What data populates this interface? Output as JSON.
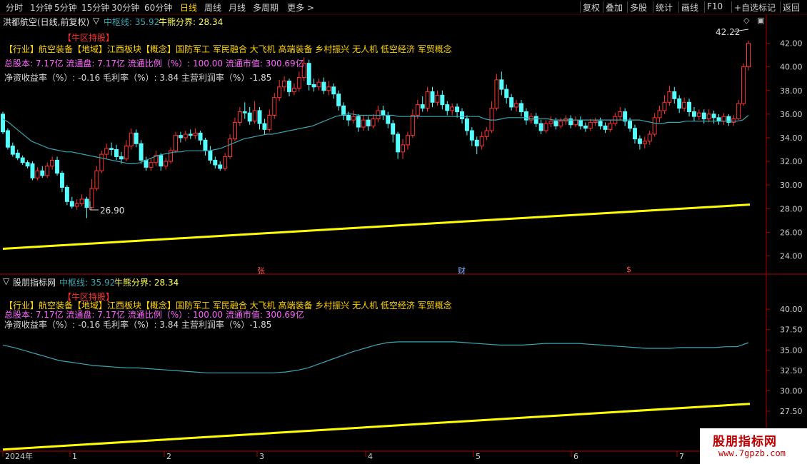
{
  "toolbar": {
    "periods": [
      "分时",
      "1分钟",
      "5分钟",
      "15分钟",
      "30分钟",
      "60分钟",
      "日线",
      "周线",
      "月线",
      "多周期",
      "更多 >"
    ],
    "active_period": "日线",
    "actions": [
      "复权",
      "叠加",
      "多股",
      "统计",
      "画线",
      "F10",
      "+自选",
      "返回"
    ],
    "mark_label": "标记"
  },
  "upper": {
    "title": "洪都航空(日线,前复权)",
    "zhongshu_label": "中枢线: 35.92",
    "niuxiong_label": "牛熊分界: 28.34",
    "badge": "【牛区持股】",
    "line1": "【行业】航空装备【地域】江西板块【概念】国防军工 军民融合 大飞机 高端装备 乡村振兴 无人机 低空经济 军贸概念",
    "line2": "总股本: 7.17亿 流通盘: 7.17亿 流通比例（%）: 100.00 流通市值: 300.69亿",
    "line3": "净资收益率（%）: -0.16 毛利率（%）: 3.84 主营利润率（%）-1.85",
    "high_label": "42.22",
    "low_label": "26.90",
    "event_marks": [
      "张",
      "财",
      "$"
    ]
  },
  "lower": {
    "title": "股朋指标网",
    "zhongshu_label": "中枢线: 35.92",
    "niuxiong_label": "牛熊分界: 28.34",
    "badge": "【牛区持股】",
    "line1": "【行业】航空装备【地域】江西板块【概念】国防军工 军民融合 大飞机 高端装备 乡村振兴 无人机 低空经济 军贸概念",
    "line2": "总股本: 7.17亿 流通盘: 7.17亿 流通比例（%）: 100.00 流通市值: 300.69亿",
    "line3": "净资收益率（%）: -0.16 毛利率（%）: 3.84 主营利润率（%）-1.85"
  },
  "xaxis": {
    "labels": [
      "2024年",
      "1",
      "2",
      "3",
      "4",
      "5",
      "6",
      "7"
    ]
  },
  "watermark": {
    "title": "股朋指标网",
    "url": "www.7gpzb.com"
  },
  "colors": {
    "up": "#ff3232",
    "down": "#54ffff",
    "zhongshu": "#3aa6b0",
    "niuxiong": "#ffff00",
    "axis": "#b00000",
    "text_yellow": "#ffd400",
    "text_magenta": "#ff66ff",
    "text_red": "#ff3030"
  },
  "chart_data": [
    {
      "type": "candlestick",
      "title": "洪都航空(日线,前复权)",
      "ylim": [
        23,
        43
      ],
      "yticks": [
        24,
        26,
        28,
        30,
        32,
        34,
        36,
        38,
        40,
        42
      ],
      "series": [
        {
          "name": "中枢线",
          "values": [
            35.6,
            35.3,
            34.9,
            34.5,
            34.1,
            33.7,
            33.5,
            33.3,
            33.1,
            33.0,
            32.9,
            32.8,
            32.8,
            32.7,
            32.6,
            32.5,
            32.4,
            32.3,
            32.2,
            32.1,
            32.0,
            31.9,
            31.8,
            31.8,
            31.9,
            32.1,
            32.3,
            32.5,
            32.6,
            32.7,
            32.8,
            32.8,
            32.9,
            32.9,
            32.9,
            32.9,
            32.9,
            33.0,
            33.1,
            33.3,
            33.5,
            33.7,
            33.9,
            34.0,
            34.1,
            34.2,
            34.3,
            34.3,
            34.4,
            34.5,
            34.6,
            34.7,
            34.8,
            34.9,
            35.0,
            35.2,
            35.4,
            35.6,
            35.8,
            35.9,
            36.0,
            36.0,
            35.9,
            35.9,
            35.9,
            35.9,
            35.9,
            35.9,
            35.9,
            35.8,
            35.8,
            35.8,
            35.8,
            35.8,
            35.8,
            35.8,
            35.8,
            35.8,
            35.8,
            35.8,
            35.8,
            35.8,
            35.8,
            35.8,
            35.6,
            35.5,
            35.5,
            35.6,
            35.7,
            35.7,
            35.7,
            35.7,
            35.6,
            35.6,
            35.6,
            35.6,
            35.5,
            35.5,
            35.5,
            35.5,
            35.5,
            35.5,
            35.5,
            35.5,
            35.5,
            35.5,
            35.5,
            35.5,
            35.5,
            35.5,
            35.5,
            35.5,
            35.4,
            35.3,
            35.2,
            35.2,
            35.3,
            35.3,
            35.3,
            35.4,
            35.4,
            35.4,
            35.4,
            35.4,
            35.4,
            35.4,
            35.4,
            35.4,
            35.4,
            35.5,
            35.9
          ]
        },
        {
          "name": "牛熊分界",
          "values": [
            24.6,
            28.34
          ]
        }
      ],
      "candles": [
        [
          36.0,
          34.5,
          36.2,
          34.3
        ],
        [
          34.6,
          33.2,
          34.8,
          33.0
        ],
        [
          33.3,
          32.6,
          33.6,
          32.4
        ],
        [
          32.7,
          32.3,
          33.0,
          32.1
        ],
        [
          32.3,
          31.9,
          32.5,
          31.7
        ],
        [
          31.9,
          31.6,
          32.1,
          31.4
        ],
        [
          31.8,
          30.6,
          32.0,
          30.4
        ],
        [
          30.6,
          31.2,
          31.5,
          30.4
        ],
        [
          31.2,
          30.8,
          31.6,
          30.6
        ],
        [
          30.8,
          31.6,
          31.9,
          30.6
        ],
        [
          31.6,
          32.1,
          32.4,
          31.3
        ],
        [
          32.1,
          31.0,
          32.4,
          30.8
        ],
        [
          31.0,
          29.8,
          31.2,
          29.4
        ],
        [
          29.8,
          28.6,
          30.0,
          28.3
        ],
        [
          28.6,
          28.2,
          29.0,
          28.0
        ],
        [
          28.2,
          28.4,
          28.8,
          27.9
        ],
        [
          28.4,
          28.8,
          29.2,
          28.2
        ],
        [
          28.8,
          28.1,
          29.0,
          27.2
        ],
        [
          28.1,
          29.7,
          30.5,
          27.9
        ],
        [
          29.7,
          31.2,
          31.6,
          29.5
        ],
        [
          31.2,
          32.6,
          32.9,
          31.0
        ],
        [
          32.6,
          33.1,
          33.5,
          32.2
        ],
        [
          33.1,
          33.0,
          33.6,
          32.5
        ],
        [
          33.0,
          32.4,
          33.4,
          32.1
        ],
        [
          32.4,
          32.2,
          32.8,
          31.8
        ],
        [
          32.2,
          33.3,
          33.8,
          32.0
        ],
        [
          33.3,
          34.4,
          34.8,
          33.0
        ],
        [
          34.4,
          33.5,
          34.7,
          33.2
        ],
        [
          33.5,
          32.1,
          33.8,
          31.8
        ],
        [
          32.1,
          31.5,
          32.4,
          31.2
        ],
        [
          31.5,
          31.9,
          32.3,
          31.2
        ],
        [
          31.9,
          32.5,
          32.9,
          31.6
        ],
        [
          32.5,
          31.6,
          32.7,
          31.2
        ],
        [
          31.6,
          32.0,
          32.3,
          31.3
        ],
        [
          32.0,
          32.9,
          33.2,
          31.8
        ],
        [
          32.9,
          34.2,
          34.5,
          32.7
        ],
        [
          34.2,
          34.0,
          34.5,
          33.6
        ],
        [
          34.0,
          34.3,
          34.6,
          33.7
        ],
        [
          34.3,
          34.2,
          34.7,
          33.9
        ],
        [
          34.2,
          34.4,
          34.8,
          33.9
        ],
        [
          34.4,
          33.8,
          34.6,
          33.4
        ],
        [
          33.8,
          32.9,
          34.0,
          32.5
        ],
        [
          32.9,
          32.1,
          33.3,
          31.8
        ],
        [
          32.1,
          31.7,
          32.4,
          31.4
        ],
        [
          31.7,
          31.4,
          32.0,
          31.2
        ],
        [
          31.4,
          32.4,
          32.7,
          31.2
        ],
        [
          32.4,
          33.9,
          34.3,
          32.2
        ],
        [
          33.9,
          35.3,
          35.7,
          33.7
        ],
        [
          35.3,
          36.2,
          36.6,
          35.0
        ],
        [
          36.2,
          36.1,
          37.0,
          35.6
        ],
        [
          36.1,
          35.4,
          36.6,
          35.1
        ],
        [
          35.4,
          36.3,
          37.1,
          35.2
        ],
        [
          36.3,
          35.2,
          36.6,
          34.7
        ],
        [
          35.2,
          34.7,
          35.6,
          34.3
        ],
        [
          34.7,
          35.9,
          36.4,
          34.5
        ],
        [
          35.9,
          37.4,
          37.8,
          35.6
        ],
        [
          37.4,
          38.3,
          38.9,
          37.1
        ],
        [
          38.3,
          38.8,
          39.2,
          37.9
        ],
        [
          38.8,
          37.9,
          39.0,
          37.5
        ],
        [
          37.9,
          38.2,
          38.6,
          37.6
        ],
        [
          38.2,
          39.1,
          39.6,
          37.9
        ],
        [
          39.1,
          40.3,
          40.8,
          38.8
        ],
        [
          40.3,
          38.5,
          40.6,
          38.0
        ],
        [
          38.5,
          38.3,
          39.0,
          37.9
        ],
        [
          38.3,
          38.7,
          39.0,
          38.0
        ],
        [
          38.7,
          38.0,
          39.1,
          37.7
        ],
        [
          38.0,
          38.3,
          38.8,
          37.6
        ],
        [
          38.3,
          37.7,
          38.6,
          37.3
        ],
        [
          37.7,
          36.7,
          38.0,
          36.3
        ],
        [
          36.7,
          35.9,
          37.0,
          35.5
        ],
        [
          35.9,
          35.5,
          36.2,
          35.0
        ],
        [
          35.5,
          35.8,
          36.3,
          35.2
        ],
        [
          35.8,
          34.9,
          36.0,
          34.5
        ],
        [
          34.9,
          35.5,
          35.9,
          34.6
        ],
        [
          35.5,
          35.0,
          35.8,
          34.6
        ],
        [
          35.0,
          35.6,
          36.0,
          34.8
        ],
        [
          35.6,
          36.3,
          36.7,
          35.3
        ],
        [
          36.3,
          35.9,
          36.7,
          35.5
        ],
        [
          35.9,
          35.2,
          36.2,
          34.8
        ],
        [
          35.2,
          34.3,
          35.5,
          33.6
        ],
        [
          34.3,
          32.8,
          34.5,
          32.2
        ],
        [
          32.8,
          33.4,
          33.9,
          32.2
        ],
        [
          33.4,
          34.2,
          34.5,
          33.0
        ],
        [
          34.2,
          35.9,
          36.4,
          34.0
        ],
        [
          35.9,
          36.8,
          37.2,
          35.6
        ],
        [
          36.8,
          36.5,
          37.5,
          36.2
        ],
        [
          36.5,
          37.9,
          38.3,
          36.2
        ],
        [
          37.9,
          37.0,
          38.3,
          36.6
        ],
        [
          37.0,
          37.6,
          38.0,
          36.7
        ],
        [
          37.6,
          36.8,
          38.0,
          36.4
        ],
        [
          36.8,
          36.3,
          37.1,
          35.9
        ],
        [
          36.3,
          36.6,
          36.9,
          35.9
        ],
        [
          36.6,
          36.2,
          36.9,
          35.7
        ],
        [
          36.2,
          35.6,
          36.5,
          35.2
        ],
        [
          35.6,
          34.6,
          35.9,
          34.2
        ],
        [
          34.6,
          33.8,
          34.9,
          33.3
        ],
        [
          33.8,
          33.3,
          34.1,
          32.6
        ],
        [
          33.3,
          34.1,
          34.5,
          33.0
        ],
        [
          34.1,
          34.6,
          34.9,
          33.8
        ],
        [
          34.6,
          36.5,
          37.1,
          34.4
        ],
        [
          36.5,
          38.9,
          39.4,
          36.3
        ],
        [
          38.9,
          38.1,
          39.6,
          37.6
        ],
        [
          38.1,
          37.4,
          38.5,
          36.9
        ],
        [
          37.4,
          36.6,
          37.7,
          36.3
        ],
        [
          36.6,
          36.9,
          37.2,
          36.2
        ],
        [
          36.9,
          36.2,
          37.2,
          35.8
        ],
        [
          36.2,
          35.5,
          36.5,
          35.1
        ],
        [
          35.5,
          35.8,
          36.1,
          35.2
        ],
        [
          35.8,
          35.2,
          36.1,
          34.9
        ],
        [
          35.2,
          34.6,
          35.5,
          34.3
        ],
        [
          34.6,
          35.2,
          35.5,
          34.4
        ],
        [
          35.2,
          35.4,
          35.8,
          34.9
        ],
        [
          35.4,
          35.0,
          35.7,
          34.7
        ],
        [
          35.0,
          35.4,
          35.7,
          34.8
        ],
        [
          35.4,
          35.6,
          35.9,
          35.1
        ],
        [
          35.6,
          35.1,
          35.9,
          34.8
        ],
        [
          35.1,
          35.5,
          35.8,
          34.9
        ],
        [
          35.5,
          35.0,
          35.8,
          34.7
        ],
        [
          35.0,
          34.8,
          35.3,
          34.5
        ],
        [
          34.8,
          35.3,
          35.6,
          34.6
        ],
        [
          35.3,
          35.4,
          35.7,
          35.0
        ],
        [
          35.4,
          35.0,
          35.7,
          34.7
        ],
        [
          35.0,
          34.7,
          35.3,
          34.4
        ],
        [
          34.7,
          35.2,
          35.5,
          34.5
        ],
        [
          35.2,
          35.8,
          36.1,
          35.0
        ],
        [
          35.8,
          36.2,
          36.6,
          35.5
        ],
        [
          36.2,
          35.4,
          36.5,
          35.0
        ],
        [
          35.4,
          34.8,
          35.7,
          34.5
        ],
        [
          34.8,
          33.9,
          35.1,
          33.5
        ],
        [
          33.9,
          33.5,
          34.2,
          33.0
        ],
        [
          33.5,
          33.7,
          34.1,
          33.1
        ],
        [
          33.7,
          34.3,
          34.6,
          33.4
        ],
        [
          34.3,
          35.7,
          36.1,
          34.1
        ],
        [
          35.7,
          36.3,
          36.7,
          35.3
        ],
        [
          36.3,
          37.0,
          37.6,
          36.0
        ],
        [
          37.0,
          37.9,
          38.4,
          36.7
        ],
        [
          37.9,
          37.3,
          38.3,
          36.9
        ],
        [
          37.3,
          36.5,
          37.6,
          36.1
        ],
        [
          36.5,
          37.0,
          37.4,
          36.2
        ],
        [
          37.0,
          36.2,
          37.3,
          35.8
        ],
        [
          36.2,
          35.8,
          36.6,
          35.4
        ],
        [
          35.8,
          36.1,
          36.4,
          35.5
        ],
        [
          36.1,
          35.6,
          36.4,
          35.2
        ],
        [
          35.6,
          36.0,
          36.4,
          35.3
        ],
        [
          36.0,
          35.7,
          36.3,
          35.2
        ],
        [
          35.7,
          35.4,
          36.0,
          35.1
        ],
        [
          35.4,
          35.8,
          36.1,
          35.1
        ],
        [
          35.8,
          35.3,
          36.0,
          35.0
        ],
        [
          35.3,
          35.6,
          35.9,
          35.0
        ],
        [
          35.6,
          36.9,
          37.2,
          35.5
        ],
        [
          36.9,
          40.0,
          40.3,
          36.7
        ],
        [
          40.0,
          42.0,
          42.2,
          39.7
        ]
      ]
    },
    {
      "type": "line",
      "title": "股朋指标网",
      "ylim": [
        22.6,
        43.6
      ],
      "yticks": [
        25.0,
        27.5,
        30.0,
        32.5,
        35.0,
        37.5,
        40.0
      ],
      "series": [
        {
          "name": "中枢线",
          "values": [
            35.6,
            35.3,
            34.9,
            34.5,
            34.1,
            33.7,
            33.5,
            33.3,
            33.1,
            33.0,
            32.9,
            32.8,
            32.8,
            32.7,
            32.6,
            32.5,
            32.4,
            32.3,
            32.2,
            32.2,
            32.2,
            32.2,
            32.2,
            32.2,
            32.2,
            32.3,
            32.5,
            32.8,
            33.3,
            33.8,
            34.3,
            34.8,
            35.2,
            35.6,
            35.9,
            36.0,
            36.0,
            36.0,
            36.0,
            36.0,
            36.0,
            35.9,
            35.8,
            35.7,
            35.6,
            35.6,
            35.6,
            35.7,
            35.8,
            35.8,
            35.8,
            35.8,
            35.7,
            35.6,
            35.5,
            35.4,
            35.3,
            35.2,
            35.2,
            35.2,
            35.3,
            35.3,
            35.3,
            35.3,
            35.4,
            35.4,
            35.9
          ]
        },
        {
          "name": "牛熊分界",
          "values": [
            22.8,
            28.4
          ]
        }
      ]
    }
  ]
}
